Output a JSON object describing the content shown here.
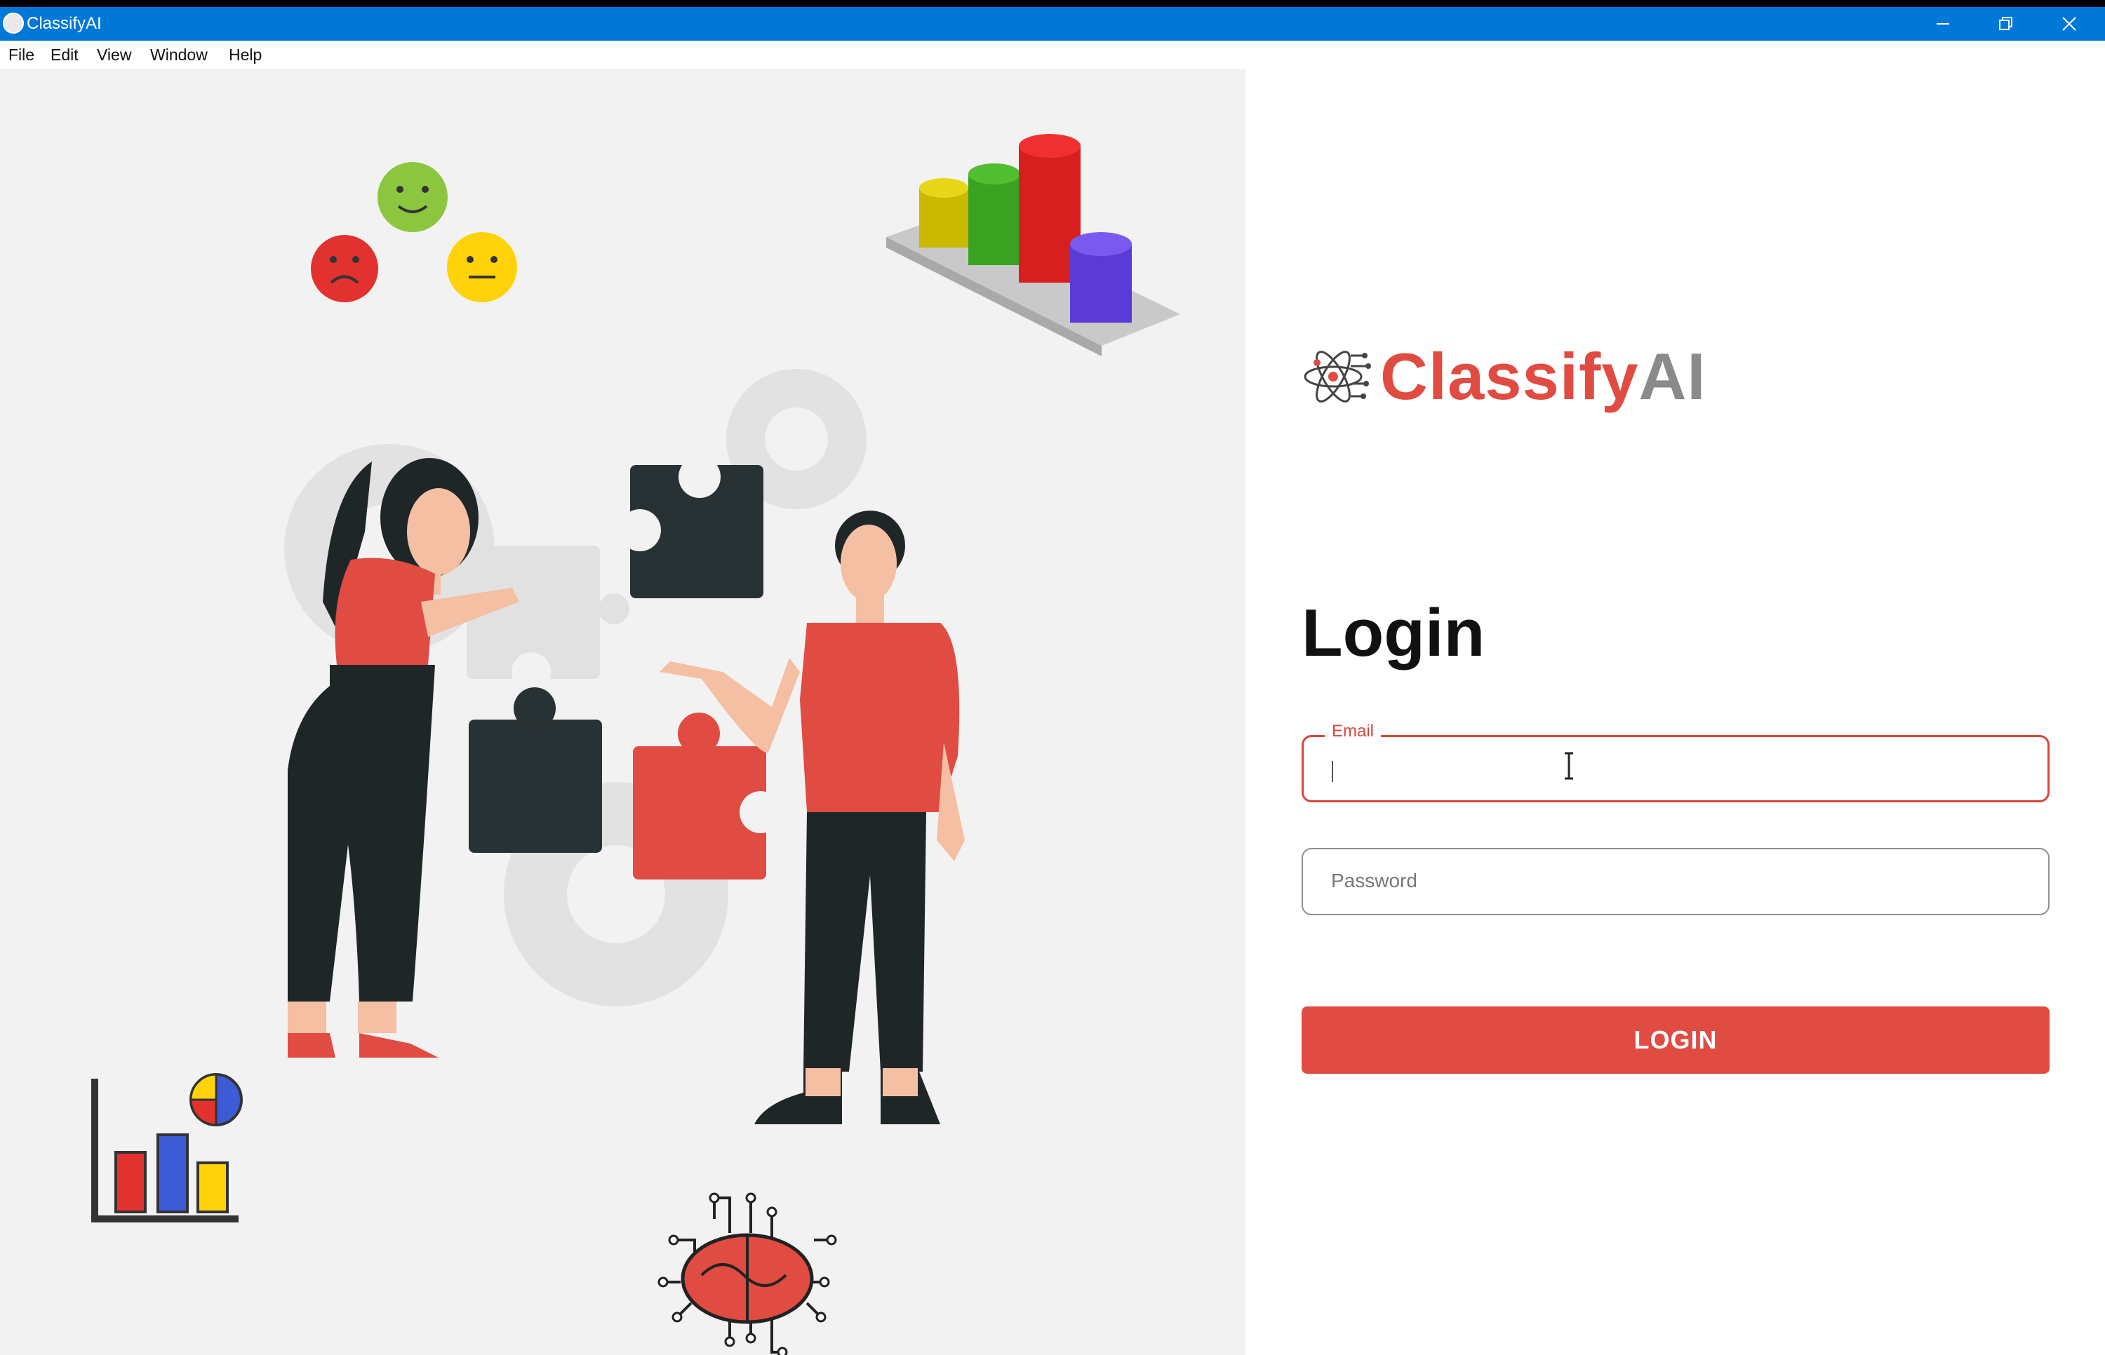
{
  "window": {
    "title": "ClassifyAI"
  },
  "menubar": {
    "items": [
      "File",
      "Edit",
      "View",
      "Window",
      "Help"
    ]
  },
  "brand": {
    "name_part1": "Classify",
    "name_part2": "AI",
    "accent_color": "#e04b42",
    "secondary_color": "#8a8a8a"
  },
  "login": {
    "heading": "Login",
    "email_label": "Email",
    "email_value": "",
    "password_placeholder": "Password",
    "button_label": "LOGIN"
  },
  "icons": {
    "app": "atom-brain-icon",
    "minimize": "minimize-icon",
    "restore": "restore-icon",
    "close": "close-icon"
  }
}
